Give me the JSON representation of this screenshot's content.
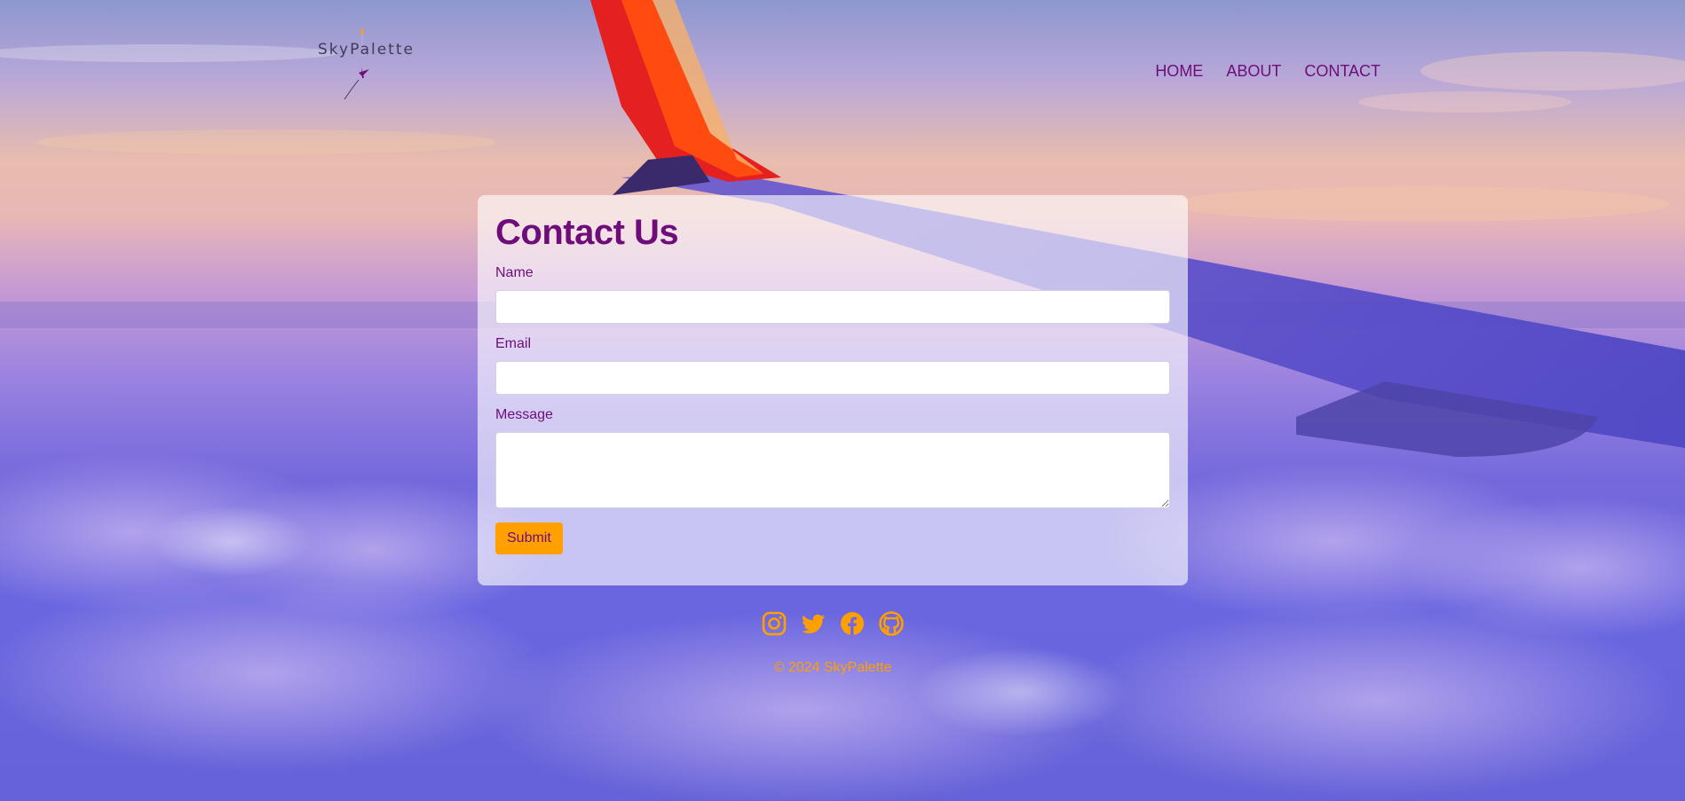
{
  "brand": {
    "name": "SkyPalette",
    "logo_icon": "airplane-icon"
  },
  "nav": {
    "items": [
      {
        "label": "HOME"
      },
      {
        "label": "ABOUT"
      },
      {
        "label": "CONTACT"
      }
    ]
  },
  "contact_form": {
    "title": "Contact Us",
    "name_label": "Name",
    "name_value": "",
    "email_label": "Email",
    "email_value": "",
    "message_label": "Message",
    "message_value": "",
    "submit_label": "Submit"
  },
  "footer": {
    "social_icons": [
      "instagram-icon",
      "twitter-icon",
      "facebook-icon",
      "github-icon"
    ],
    "copyright": "© 2024 SkyPalette"
  },
  "colors": {
    "primary": "#6e0d7a",
    "accent": "#ff9f00",
    "card_bg": "rgba(255,255,255,0.62)"
  }
}
